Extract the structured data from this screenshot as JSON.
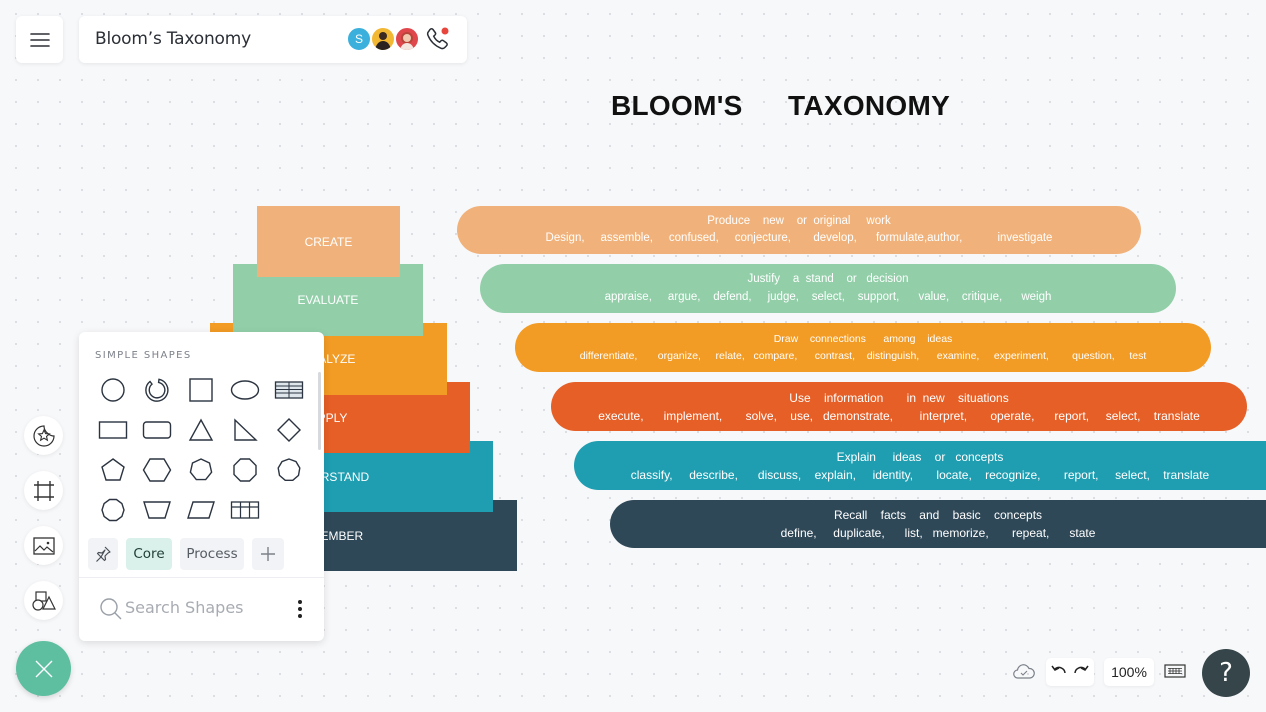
{
  "header": {
    "menu_icon": "hamburger-menu-icon",
    "doc_title": "Bloom’s Taxonomy",
    "collaborators": [
      {
        "initial": "S",
        "color": "#3bb0dc"
      },
      {
        "initial": "",
        "color": "#f2b733"
      },
      {
        "initial": "",
        "color": "#e0474c"
      }
    ],
    "call_icon": "phone-call-icon",
    "call_indicator_color": "#e8453c"
  },
  "canvas": {
    "title_left": "BLOOM'S",
    "title_right": "TAXONOMY",
    "pyramid": [
      {
        "label": "CREATE",
        "visible_label": "CREATE",
        "color": "#f0b27a"
      },
      {
        "label": "EVALUATE",
        "visible_label": "EVALUATE",
        "color": "#92cfa9"
      },
      {
        "label": "ANALYZE",
        "visible_label": "YZE",
        "color": "#f29b25"
      },
      {
        "label": "APPLY",
        "visible_label": "PLY",
        "color": "#e65f27"
      },
      {
        "label": "UNDERSTAND",
        "visible_label": "TAND",
        "color": "#1f9db1"
      },
      {
        "label": "REMEMBER",
        "visible_label": "BER",
        "color": "#2f4858"
      }
    ],
    "descriptions": [
      {
        "headline": "Produce    new    or  original     work",
        "verbs": "Design,     assemble,     confused,     conjecture,       develop,      formulate,author,           investigate",
        "color": "#f0b27a"
      },
      {
        "headline": "Justify    a  stand    or   decision",
        "verbs": "appraise,     argue,    defend,     judge,    select,    support,      value,    critique,      weigh",
        "color": "#92cfa9"
      },
      {
        "headline": "Draw    connections      among    ideas",
        "verbs": "differentiate,       organize,     relate,   compare,      contrast,    distinguish,      examine,     experiment,        question,     test",
        "color": "#f29b25"
      },
      {
        "headline": "Use    information       in  new    situations",
        "verbs": "execute,      implement,       solve,    use,   demonstrate,        interpret,       operate,      report,     select,    translate",
        "color": "#e65f27"
      },
      {
        "headline": "Explain     ideas    or   concepts",
        "verbs": "classify,     describe,      discuss,    explain,     identity,       locate,    recognize,       report,     select,    translate",
        "color": "#1f9db1"
      },
      {
        "headline": "Recall    facts    and    basic    concepts",
        "verbs": "define,     duplicate,      list,   memorize,       repeat,      state",
        "color": "#2f4858"
      }
    ]
  },
  "shapes_panel": {
    "heading": "SIMPLE SHAPES",
    "shapes": [
      "circle",
      "partial-circle",
      "square",
      "ellipse",
      "table-lined",
      "rectangle",
      "rounded-rectangle",
      "triangle",
      "right-triangle",
      "diamond",
      "pentagon",
      "hexagon",
      "heptagon",
      "octagon",
      "nonagon",
      "decagon",
      "trapezoid",
      "parallelogram",
      "grid-table"
    ],
    "tabs": [
      {
        "label": "Core",
        "active": true
      },
      {
        "label": "Process",
        "active": false
      }
    ],
    "pin_icon": "pin-icon",
    "add_icon": "plus-icon",
    "search_placeholder": "Search Shapes",
    "more_icon": "more-vertical-icon"
  },
  "left_rail": [
    {
      "name": "sticker-icon"
    },
    {
      "name": "frame-icon"
    },
    {
      "name": "image-icon"
    },
    {
      "name": "shapes-icon"
    }
  ],
  "fab_icon": "close-icon",
  "bottom_bar": {
    "cloud_icon": "cloud-saved-icon",
    "undo_icon": "undo-icon",
    "redo_icon": "redo-icon",
    "zoom_level": "100%",
    "keyboard_icon": "keyboard-icon",
    "help_label": "?"
  }
}
